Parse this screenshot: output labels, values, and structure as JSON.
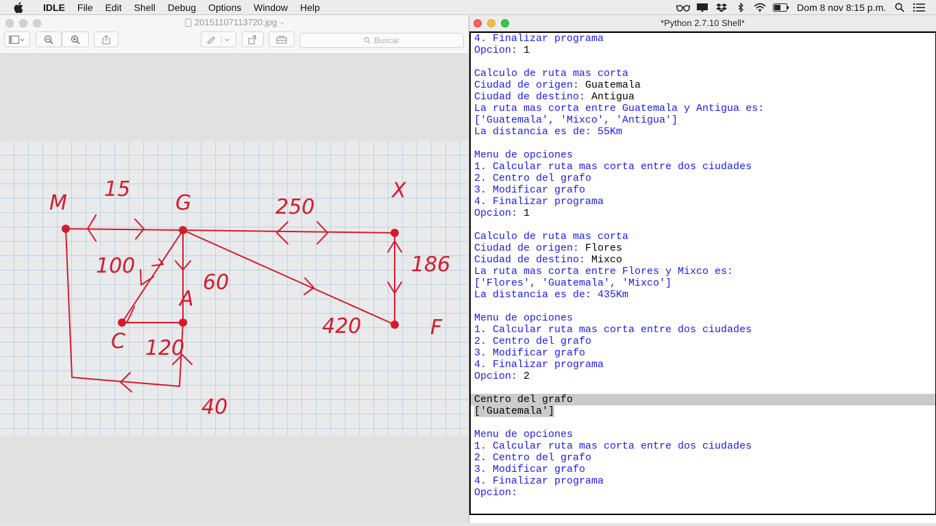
{
  "menubar": {
    "apple_icon": "apple-logo",
    "app_name": "IDLE",
    "items": [
      "File",
      "Edit",
      "Shell",
      "Debug",
      "Options",
      "Window",
      "Help"
    ],
    "clock": "Dom 8 nov  8:15 p.m.",
    "status_icons": [
      "glasses-icon",
      "display-icon",
      "dropbox-icon",
      "bluetooth-icon",
      "wifi-icon",
      "battery-icon",
      "search-icon",
      "list-icon"
    ]
  },
  "preview": {
    "title": "20151107113720.jpg",
    "search_placeholder": "Buscar",
    "photo_labels": {
      "node_m": "M",
      "node_g": "G",
      "node_x": "X",
      "node_a": "A",
      "node_c": "C",
      "node_f": "F",
      "w_mg": "15",
      "w_gx": "250",
      "w_mc": "100",
      "w_ga": "60",
      "w_xf": "186",
      "w_gf": "420",
      "w_ca": "120",
      "w_bottom": "40"
    }
  },
  "shell": {
    "title": "*Python 2.7.10 Shell*",
    "lines": [
      {
        "text": "4. Finalizar programa"
      },
      {
        "text": "Opcion: ",
        "input": "1"
      },
      {
        "text": ""
      },
      {
        "text": "Calculo de ruta mas corta"
      },
      {
        "text": "Ciudad de origen: ",
        "input": "Guatemala"
      },
      {
        "text": "Ciudad de destino: ",
        "input": "Antigua"
      },
      {
        "text": "La ruta mas corta entre Guatemala y Antigua es:"
      },
      {
        "text": "['Guatemala', 'Mixco', 'Antigua']"
      },
      {
        "text": "La distancia es de: 55Km"
      },
      {
        "text": ""
      },
      {
        "text": "Menu de opciones"
      },
      {
        "text": "1. Calcular ruta mas corta entre dos ciudades"
      },
      {
        "text": "2. Centro del grafo"
      },
      {
        "text": "3. Modificar grafo"
      },
      {
        "text": "4. Finalizar programa"
      },
      {
        "text": "Opcion: ",
        "input": "1"
      },
      {
        "text": ""
      },
      {
        "text": "Calculo de ruta mas corta"
      },
      {
        "text": "Ciudad de origen: ",
        "input": "Flores"
      },
      {
        "text": "Ciudad de destino: ",
        "input": "Mixco"
      },
      {
        "text": "La ruta mas corta entre Flores y Mixco es:"
      },
      {
        "text": "['Flores', 'Guatemala', 'Mixco']"
      },
      {
        "text": "La distancia es de: 435Km"
      },
      {
        "text": ""
      },
      {
        "text": "Menu de opciones"
      },
      {
        "text": "1. Calcular ruta mas corta entre dos ciudades"
      },
      {
        "text": "2. Centro del grafo"
      },
      {
        "text": "3. Modificar grafo"
      },
      {
        "text": "4. Finalizar programa"
      },
      {
        "text": "Opcion: ",
        "input": "2"
      },
      {
        "text": ""
      },
      {
        "text": "Centro del grafo",
        "selected": "full"
      },
      {
        "text": "['Guatemala']",
        "selected": "partial"
      },
      {
        "text": ""
      },
      {
        "text": "Menu de opciones"
      },
      {
        "text": "1. Calcular ruta mas corta entre dos ciudades"
      },
      {
        "text": "2. Centro del grafo"
      },
      {
        "text": "3. Modificar grafo"
      },
      {
        "text": "4. Finalizar programa"
      },
      {
        "text": "Opcion: "
      }
    ]
  }
}
